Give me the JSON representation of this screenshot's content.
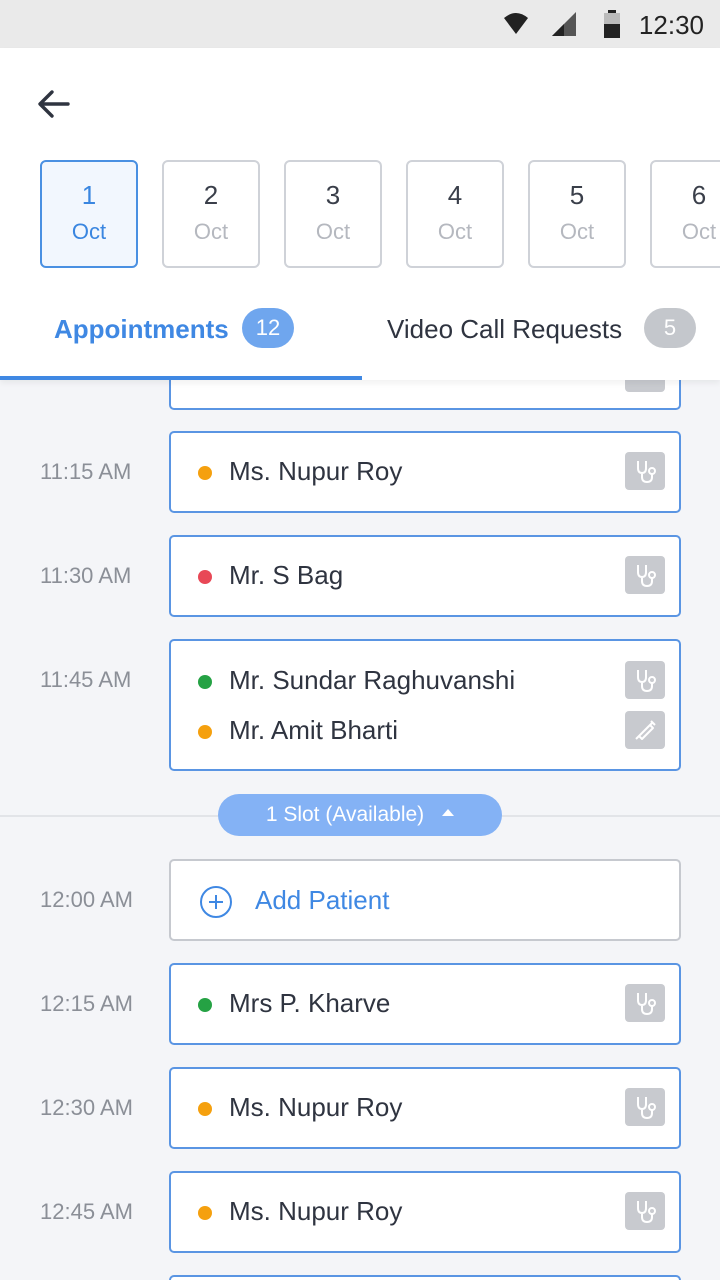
{
  "status_bar": {
    "time": "12:30"
  },
  "dates": [
    {
      "day": "1",
      "month": "Oct",
      "active": true
    },
    {
      "day": "2",
      "month": "Oct",
      "active": false
    },
    {
      "day": "3",
      "month": "Oct",
      "active": false
    },
    {
      "day": "4",
      "month": "Oct",
      "active": false
    },
    {
      "day": "5",
      "month": "Oct",
      "active": false
    },
    {
      "day": "6",
      "month": "Oct",
      "active": false
    }
  ],
  "tabs": [
    {
      "label": "Appointments",
      "count": "12",
      "active": true
    },
    {
      "label": "Video Call Requests",
      "count": "5",
      "active": false
    }
  ],
  "status_colors": {
    "orange": "#f5a00e",
    "red": "#e84856",
    "green": "#25a244"
  },
  "slots": [
    {
      "time": "11:15 AM",
      "patients": [
        {
          "name": "Ms. Nupur Roy",
          "status": "orange",
          "icon": "stethoscope-icon"
        }
      ]
    },
    {
      "time": "11:30 AM",
      "patients": [
        {
          "name": "Mr. S Bag",
          "status": "red",
          "icon": "stethoscope-icon"
        }
      ]
    },
    {
      "time": "11:45 AM",
      "patients": [
        {
          "name": "Mr. Sundar Raghuvanshi",
          "status": "green",
          "icon": "stethoscope-icon"
        },
        {
          "name": "Mr. Amit Bharti",
          "status": "orange",
          "icon": "syringe-icon"
        }
      ]
    }
  ],
  "available_pill": {
    "label": "1 Slot (Available)"
  },
  "add_slot": {
    "time": "12:00 AM",
    "label": "Add Patient"
  },
  "later_slots": [
    {
      "time": "12:15 AM",
      "patients": [
        {
          "name": "Mrs P. Kharve",
          "status": "green",
          "icon": "stethoscope-icon"
        }
      ]
    },
    {
      "time": "12:30 AM",
      "patients": [
        {
          "name": "Ms. Nupur Roy",
          "status": "orange",
          "icon": "stethoscope-icon"
        }
      ]
    },
    {
      "time": "12:45 AM",
      "patients": [
        {
          "name": "Ms. Nupur Roy",
          "status": "orange",
          "icon": "stethoscope-icon"
        }
      ]
    }
  ]
}
